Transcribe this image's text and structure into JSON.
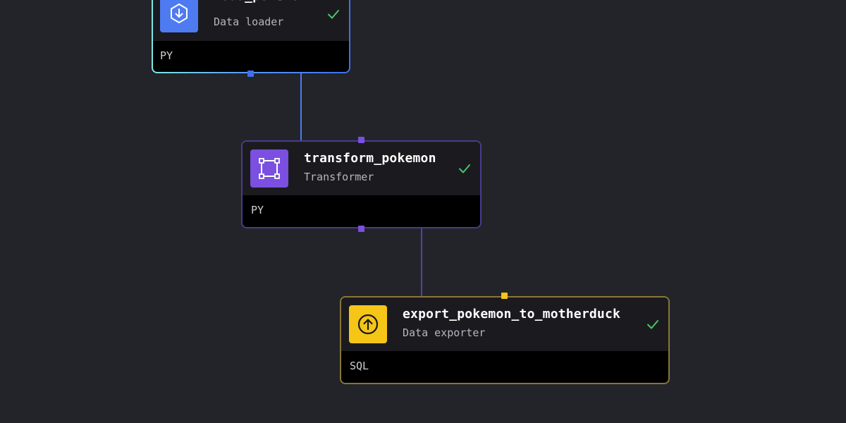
{
  "colors": {
    "background": "#232429",
    "loader_accent": "#4e7bf2",
    "transformer_accent": "#7b4fe0",
    "exporter_accent": "#f5c518",
    "status_ok": "#47c66a"
  },
  "blocks": {
    "load": {
      "name": "load_pokemon",
      "type": "Data loader",
      "language": "PY",
      "status": "success",
      "icon": "download-hexagon-icon"
    },
    "transform": {
      "name": "transform_pokemon",
      "type": "Transformer",
      "language": "PY",
      "status": "success",
      "icon": "frame-select-icon"
    },
    "export": {
      "name": "export_pokemon_to_motherduck",
      "type": "Data exporter",
      "language": "SQL",
      "status": "success",
      "icon": "upload-circle-icon"
    }
  }
}
